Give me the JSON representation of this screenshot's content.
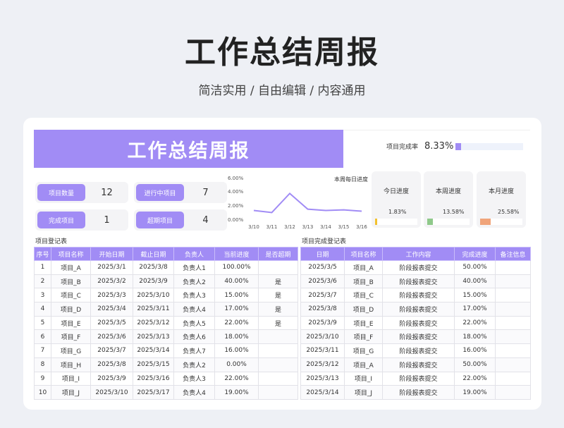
{
  "page": {
    "title": "工作总结周报",
    "subtitle": "简洁实用 / 自由编辑 / 内容通用"
  },
  "banner": {
    "title": "工作总结周报"
  },
  "overall": {
    "label": "项目完成率",
    "value": "8.33%",
    "fraction": 0.0833,
    "color": "#a18cf5"
  },
  "stats": [
    {
      "label": "项目数量",
      "value": "12"
    },
    {
      "label": "进行中项目",
      "value": "7"
    },
    {
      "label": "完成项目",
      "value": "1"
    },
    {
      "label": "超期项目",
      "value": "4"
    }
  ],
  "chart_data": {
    "type": "line",
    "title": "本周每日进度",
    "x": [
      "3/10",
      "3/11",
      "3/12",
      "3/13",
      "3/14",
      "3/15",
      "3/16"
    ],
    "values": [
      1.6,
      1.3,
      4.1,
      1.8,
      1.6,
      1.7,
      1.5
    ],
    "y_ticks": [
      "6.00%",
      "4.00%",
      "2.00%",
      "0.00%"
    ],
    "ylim": [
      0,
      6
    ],
    "color": "#a18cf5"
  },
  "progress": [
    {
      "label": "今日进度",
      "value": "1.83%",
      "fraction": 0.0183,
      "color": "#f2c12e"
    },
    {
      "label": "本周进度",
      "value": "13.58%",
      "fraction": 0.1358,
      "color": "#8fc98a"
    },
    {
      "label": "本月进度",
      "value": "25.58%",
      "fraction": 0.2558,
      "color": "#f0a47a"
    }
  ],
  "registry": {
    "title": "项目登记表",
    "headers": [
      "序号",
      "项目名称",
      "开始日期",
      "截止日期",
      "负责人",
      "当前进度",
      "是否超期"
    ],
    "rows": [
      [
        "1",
        "项目_A",
        "2025/3/1",
        "2025/3/8",
        "负责人1",
        "100.00%",
        ""
      ],
      [
        "2",
        "项目_B",
        "2025/3/2",
        "2025/3/9",
        "负责人2",
        "40.00%",
        "是"
      ],
      [
        "3",
        "项目_C",
        "2025/3/3",
        "2025/3/10",
        "负责人3",
        "15.00%",
        "是"
      ],
      [
        "4",
        "项目_D",
        "2025/3/4",
        "2025/3/11",
        "负责人4",
        "17.00%",
        "是"
      ],
      [
        "5",
        "项目_E",
        "2025/3/5",
        "2025/3/12",
        "负责人5",
        "22.00%",
        "是"
      ],
      [
        "6",
        "项目_F",
        "2025/3/6",
        "2025/3/13",
        "负责人6",
        "18.00%",
        ""
      ],
      [
        "7",
        "项目_G",
        "2025/3/7",
        "2025/3/14",
        "负责人7",
        "16.00%",
        ""
      ],
      [
        "8",
        "项目_H",
        "2025/3/8",
        "2025/3/15",
        "负责人2",
        "0.00%",
        ""
      ],
      [
        "9",
        "项目_I",
        "2025/3/9",
        "2025/3/16",
        "负责人3",
        "22.00%",
        ""
      ],
      [
        "10",
        "项目_J",
        "2025/3/10",
        "2025/3/17",
        "负责人4",
        "19.00%",
        ""
      ]
    ]
  },
  "completion": {
    "title": "项目完成登记表",
    "headers": [
      "日期",
      "项目名称",
      "工作内容",
      "完成进度",
      "备注信息"
    ],
    "rows": [
      [
        "2025/3/5",
        "项目_A",
        "阶段报表提交",
        "50.00%",
        ""
      ],
      [
        "2025/3/6",
        "项目_B",
        "阶段报表提交",
        "40.00%",
        ""
      ],
      [
        "2025/3/7",
        "项目_C",
        "阶段报表提交",
        "15.00%",
        ""
      ],
      [
        "2025/3/8",
        "项目_D",
        "阶段报表提交",
        "17.00%",
        ""
      ],
      [
        "2025/3/9",
        "项目_E",
        "阶段报表提交",
        "22.00%",
        ""
      ],
      [
        "2025/3/10",
        "项目_F",
        "阶段报表提交",
        "18.00%",
        ""
      ],
      [
        "2025/3/11",
        "项目_G",
        "阶段报表提交",
        "16.00%",
        ""
      ],
      [
        "2025/3/12",
        "项目_A",
        "阶段报表提交",
        "50.00%",
        ""
      ],
      [
        "2025/3/13",
        "项目_I",
        "阶段报表提交",
        "22.00%",
        ""
      ],
      [
        "2025/3/14",
        "项目_J",
        "阶段报表提交",
        "19.00%",
        ""
      ]
    ]
  }
}
